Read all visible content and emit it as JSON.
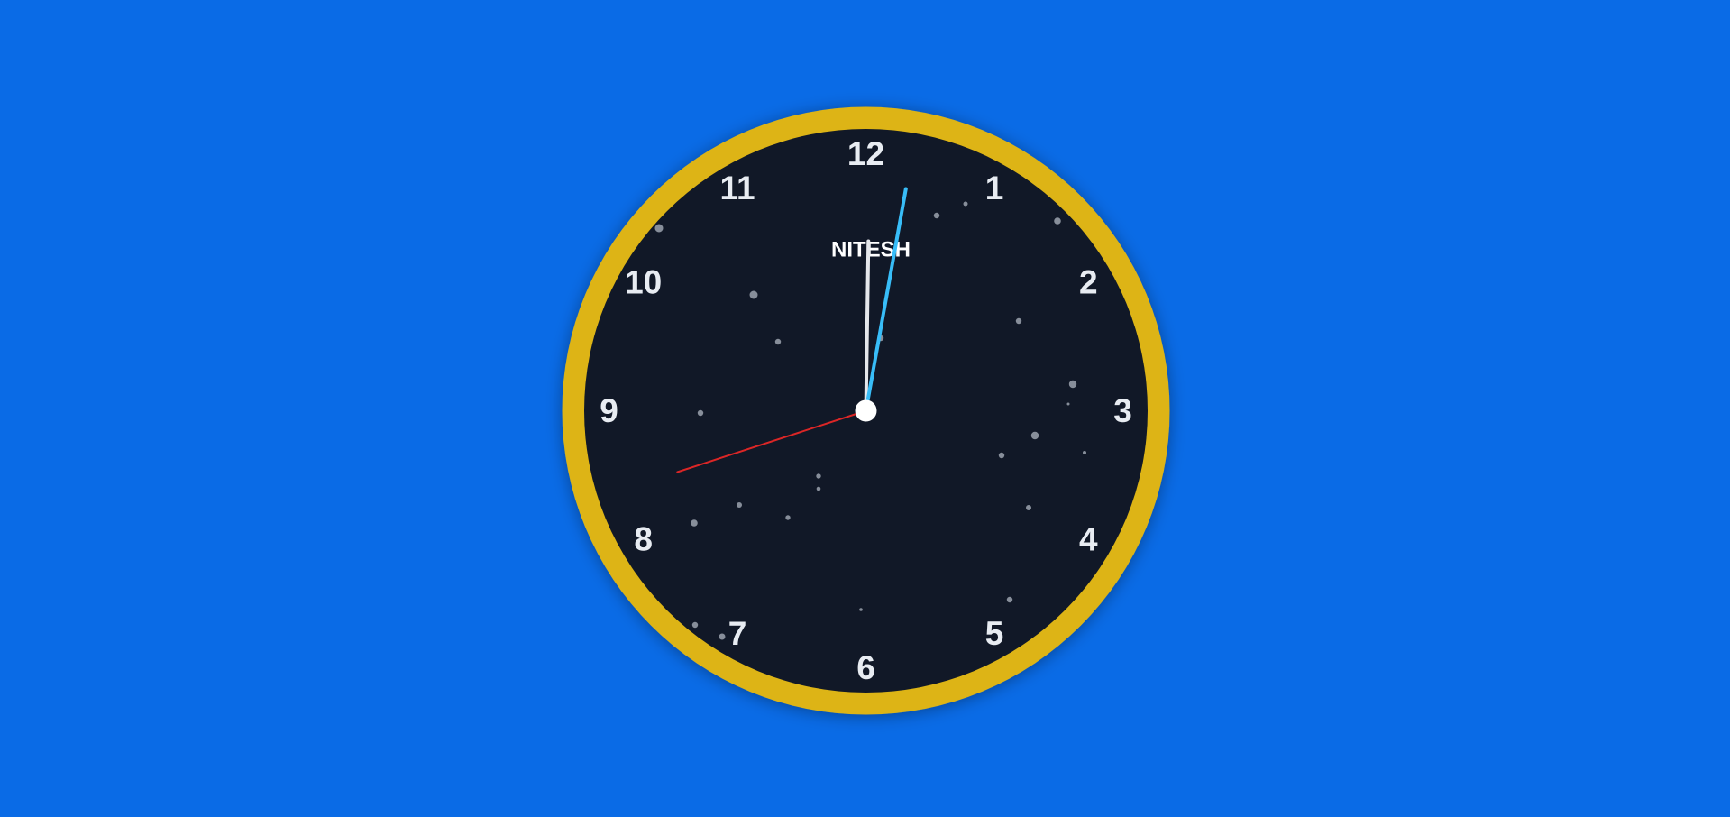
{
  "page": {
    "background_color": "#0a6be6"
  },
  "clock": {
    "brand_label": "NITESH",
    "numerals": [
      "12",
      "1",
      "2",
      "3",
      "4",
      "5",
      "6",
      "7",
      "8",
      "9",
      "10",
      "11"
    ],
    "time": {
      "hour": 0,
      "minute": 1,
      "second": 42
    },
    "colors": {
      "rim": "#ddb416",
      "face": "#111827",
      "hour_hand": "#e5e7eb",
      "minute_hand": "#38bdf8",
      "second_hand": "#dc2626",
      "center_pin": "#ffffff",
      "numerals": "#e8ecf2",
      "stars": "#9ca3af"
    },
    "decoration": "star-dots"
  }
}
